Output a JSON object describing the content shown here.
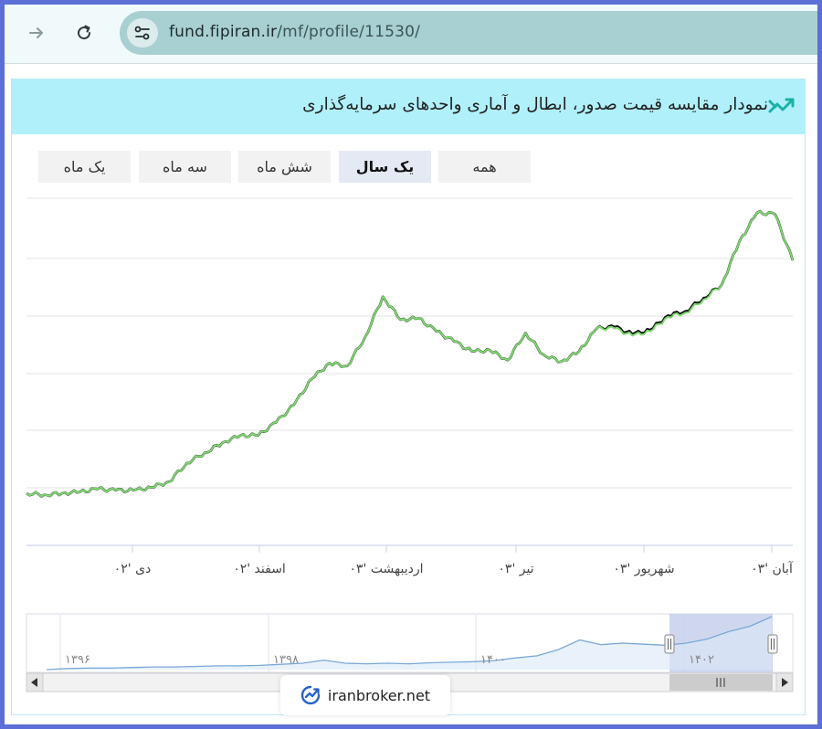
{
  "browser": {
    "url_host": "fund.fipiran.ir",
    "url_path": "/mf/profile/11530/"
  },
  "card": {
    "title": "نمودار مقایسه قیمت صدور، ابطال و آماری واحدهای سرمایه‌گذاری"
  },
  "range_buttons": [
    {
      "label": "همه",
      "active": false
    },
    {
      "label": "یک سال",
      "active": true
    },
    {
      "label": "شش ماه",
      "active": false
    },
    {
      "label": "سه ماه",
      "active": false
    },
    {
      "label": "یک ماه",
      "active": false
    }
  ],
  "navigator": {
    "labels": [
      "۱۳۹۶",
      "۱۳۹۸",
      "۱۴۰۰",
      "۱۴۰۲"
    ]
  },
  "watermark": {
    "text": "iranbroker.net"
  },
  "colors": {
    "issue_line": "#7ddb6e",
    "redemption_line": "#111111",
    "navigator_line": "#7aa8d8",
    "navigator_selection": "#c7d0ec",
    "header_bg": "#b0f0fb",
    "frame_border": "#5b6fd6"
  },
  "chart_data": {
    "type": "line",
    "x_tick_labels": [
      "دی '۰۲",
      "اسفند '۰۲",
      "اردیبهشت '۰۳",
      "تیر '۰۳",
      "شهریور '۰۳",
      "آبان '۰۳"
    ],
    "series": [
      {
        "name": "",
        "color": "#111111",
        "values": [
          9.6,
          9.5,
          9.6,
          9.7,
          9.9,
          9.8,
          9.8,
          10.0,
          10.4,
          11.7,
          12.4,
          13.1,
          13.6,
          13.6,
          14.5,
          15.7,
          17.5,
          18.6,
          18.4,
          20.4,
          23.2,
          21.6,
          21.7,
          20.8,
          20.1,
          19.4,
          19.5,
          18.8,
          20.7,
          19.2,
          18.7,
          19.4,
          21.0,
          21.1,
          20.6,
          20.9,
          21.9,
          22.2,
          23.1,
          24.0,
          27.0,
          29.0,
          28.9,
          25.7
        ]
      },
      {
        "name": "",
        "color": "#7ddb6e",
        "values": [
          9.6,
          9.5,
          9.6,
          9.7,
          9.9,
          9.8,
          9.8,
          10.0,
          10.4,
          11.7,
          12.4,
          13.1,
          13.6,
          13.6,
          14.5,
          15.7,
          17.5,
          18.6,
          18.4,
          20.4,
          23.2,
          21.6,
          21.7,
          20.8,
          20.1,
          19.4,
          19.5,
          18.8,
          20.7,
          19.2,
          18.7,
          19.4,
          21.0,
          21.0,
          20.5,
          20.8,
          21.8,
          22.1,
          23.0,
          24.0,
          27.0,
          29.0,
          28.9,
          25.7
        ]
      }
    ],
    "ylim": [
      6,
      30
    ],
    "grid": true,
    "legend": "none"
  }
}
